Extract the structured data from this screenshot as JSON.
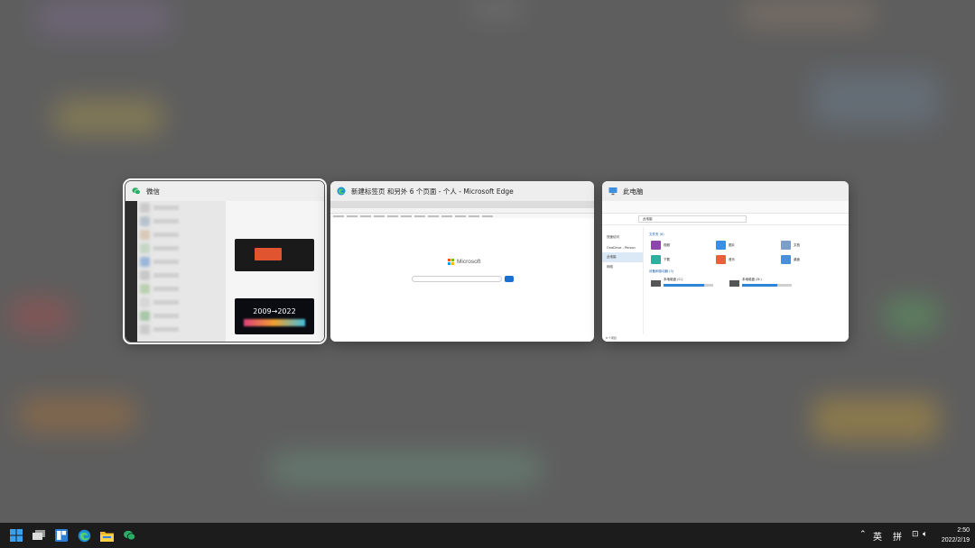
{
  "switcher": {
    "windows": [
      {
        "title": "微信",
        "app": "wechat",
        "selected": true
      },
      {
        "title": "新建标签页 和另外 6 个页面 - 个人 - Microsoft Edge",
        "app": "edge",
        "selected": false
      },
      {
        "title": "此电脑",
        "app": "file-explorer",
        "selected": false
      }
    ]
  },
  "edge_thumb": {
    "brand": "Microsoft"
  },
  "explorer_thumb": {
    "address": "此电脑",
    "nav": [
      "快速访问",
      "OneDrive - Person",
      "此电脑",
      "网络"
    ],
    "folders_heading": "文件夹 (6)",
    "folders": [
      "视频",
      "图片",
      "文档",
      "下载",
      "音乐",
      "桌面"
    ],
    "folder_colors": [
      "#8e44ad",
      "#3a8ee6",
      "#7b9fc8",
      "#2bb0a0",
      "#e8603c",
      "#4a90d9"
    ],
    "drives_heading": "设备和驱动器 (3)",
    "drives": [
      {
        "name": "本地磁盘 (C:)",
        "used_fraction": 0.82
      },
      {
        "name": "本地磁盘 (D:)",
        "used_fraction": 0.7
      }
    ],
    "status": "8 个项目"
  },
  "taskbar": {
    "apps": [
      "start-icon",
      "desktop-icon",
      "widgets-icon",
      "edge-icon",
      "file-explorer-icon",
      "wechat-icon"
    ],
    "ime_language": "英",
    "ime_mode": "拼",
    "time": "2:50",
    "date": "2022/2/19"
  }
}
